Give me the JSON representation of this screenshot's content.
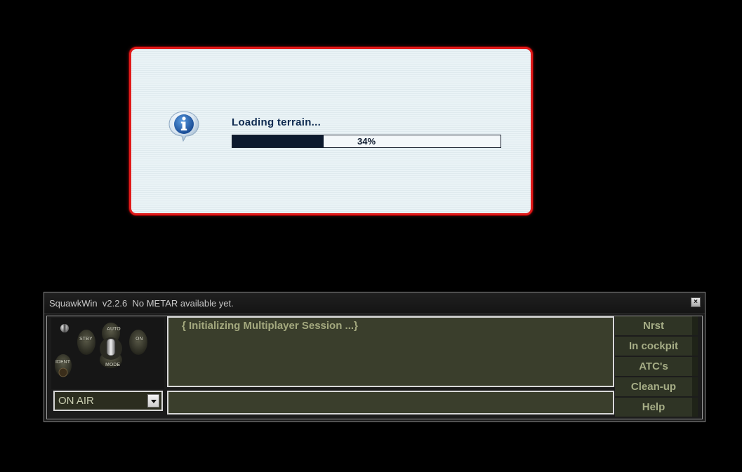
{
  "loading": {
    "message": "Loading terrain...",
    "progress_text": "34%",
    "progress_fraction": 0.34,
    "icon": "info-icon",
    "border_color": "#e01a1a"
  },
  "squawkwin": {
    "title": "SquawkWin  v2.2.6  No METAR available yet.",
    "close_glyph": "×",
    "transponder": {
      "label_auto": "AUTO",
      "label_stby": "STBY",
      "label_on": "ON",
      "label_mode": "MODE",
      "label_ident": "IDENT"
    },
    "mode_select": {
      "value": "ON AIR"
    },
    "message": "{ Initializing Multiplayer Session ...}",
    "input_value": "",
    "buttons": [
      "Nrst",
      "In cockpit",
      "ATC's",
      "Clean-up",
      "Help"
    ],
    "text_color": "#a6ad86",
    "pane_color": "#3a3e2c"
  }
}
